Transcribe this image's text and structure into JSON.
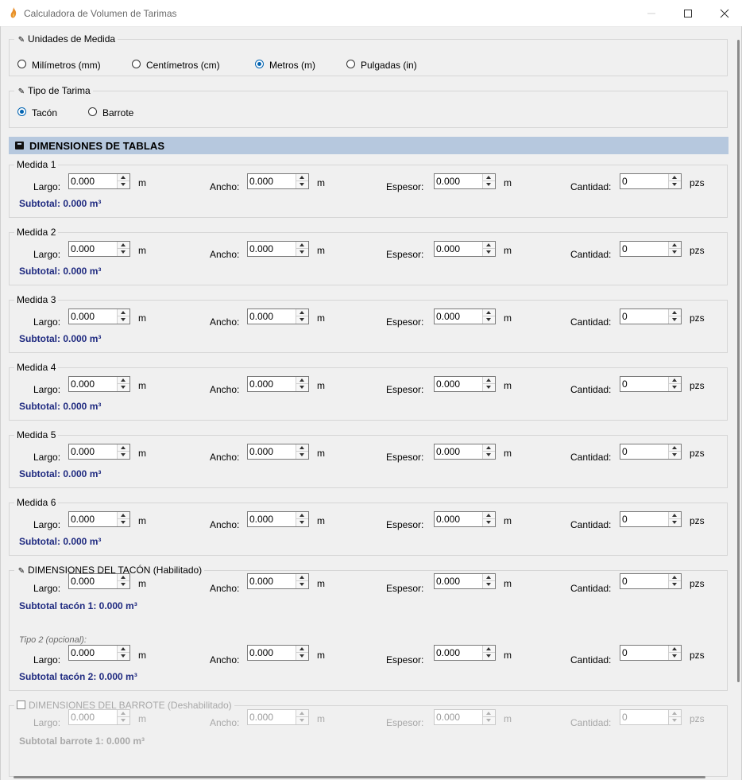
{
  "window": {
    "title": "Calculadora de Volumen de Tarimas",
    "controls": {
      "minimize": "—",
      "maximize": "☐",
      "close": "✕"
    }
  },
  "units": {
    "legend": "Unidades de Medida",
    "legend_icon": "📏",
    "options": [
      {
        "label": "Milímetros (mm)",
        "selected": false
      },
      {
        "label": "Centímetros (cm)",
        "selected": false
      },
      {
        "label": "Metros (m)",
        "selected": true
      },
      {
        "label": "Pulgadas (in)",
        "selected": false
      }
    ]
  },
  "pallet_type": {
    "legend": "Tipo de Tarima",
    "legend_icon": "✎",
    "options": [
      {
        "label": "Tacón",
        "selected": true
      },
      {
        "label": "Barrote",
        "selected": false
      }
    ]
  },
  "boards_section": {
    "title": "DIMENSIONES DE TABLAS"
  },
  "labels": {
    "largo": "Largo:",
    "ancho": "Ancho:",
    "espesor": "Espesor:",
    "cantidad": "Cantidad:",
    "unit_m": "m",
    "unit_pzs": "pzs"
  },
  "measures": [
    {
      "legend": "Medida 1",
      "largo": "0.000",
      "ancho": "0.000",
      "espesor": "0.000",
      "cantidad": "0",
      "subtotal": "Subtotal: 0.000 m³"
    },
    {
      "legend": "Medida 2",
      "largo": "0.000",
      "ancho": "0.000",
      "espesor": "0.000",
      "cantidad": "0",
      "subtotal": "Subtotal: 0.000 m³"
    },
    {
      "legend": "Medida 3",
      "largo": "0.000",
      "ancho": "0.000",
      "espesor": "0.000",
      "cantidad": "0",
      "subtotal": "Subtotal: 0.000 m³"
    },
    {
      "legend": "Medida 4",
      "largo": "0.000",
      "ancho": "0.000",
      "espesor": "0.000",
      "cantidad": "0",
      "subtotal": "Subtotal: 0.000 m³"
    },
    {
      "legend": "Medida 5",
      "largo": "0.000",
      "ancho": "0.000",
      "espesor": "0.000",
      "cantidad": "0",
      "subtotal": "Subtotal: 0.000 m³"
    },
    {
      "legend": "Medida 6",
      "largo": "0.000",
      "ancho": "0.000",
      "espesor": "0.000",
      "cantidad": "0",
      "subtotal": "Subtotal: 0.000 m³"
    }
  ],
  "tacon": {
    "legend": "DIMENSIONES DEL TACÓN (Habilitado)",
    "legend_icon": "✎",
    "type2_label": "Tipo 2 (opcional):",
    "rows": [
      {
        "largo": "0.000",
        "ancho": "0.000",
        "espesor": "0.000",
        "cantidad": "0",
        "subtotal": "Subtotal tacón 1: 0.000 m³"
      },
      {
        "largo": "0.000",
        "ancho": "0.000",
        "espesor": "0.000",
        "cantidad": "0",
        "subtotal": "Subtotal tacón 2: 0.000 m³"
      }
    ]
  },
  "barrote": {
    "legend": "DIMENSIONES DEL BARROTE (Deshabilitado)",
    "rows": [
      {
        "largo": "0.000",
        "ancho": "0.000",
        "espesor": "0.000",
        "cantidad": "0",
        "subtotal": "Subtotal barrote 1: 0.000 m³"
      }
    ]
  }
}
